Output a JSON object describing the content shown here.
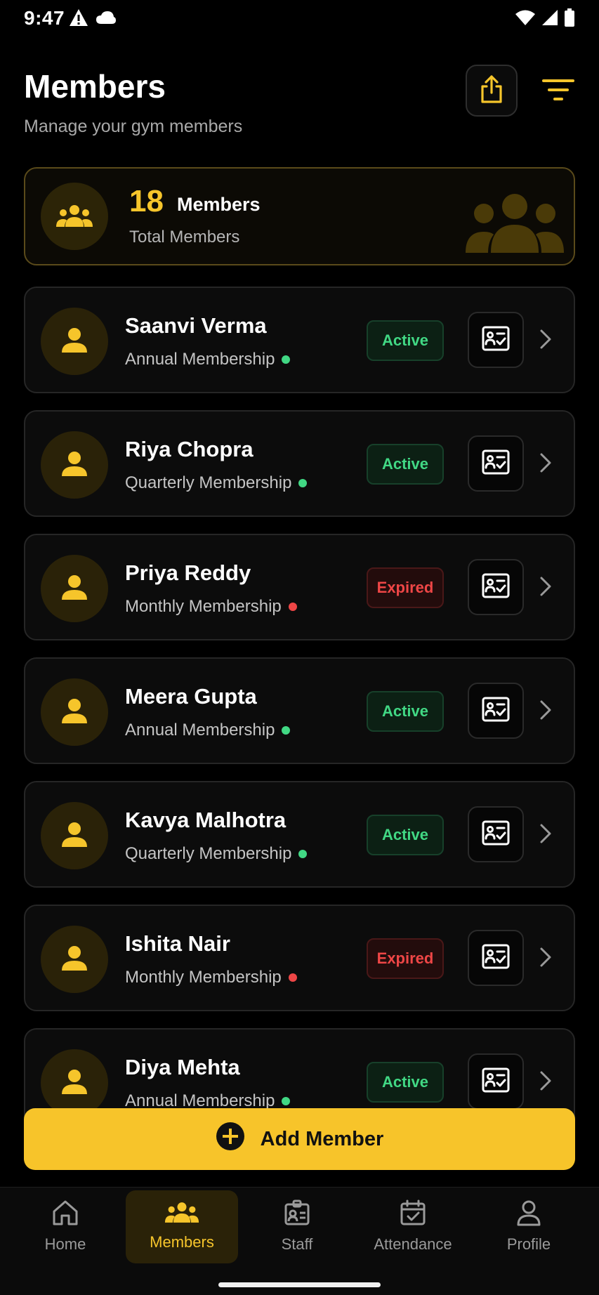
{
  "status_bar": {
    "time": "9:47"
  },
  "header": {
    "title": "Members",
    "subtitle": "Manage your gym members"
  },
  "summary": {
    "count": "18",
    "count_label": "Members",
    "label": "Total Members"
  },
  "members": [
    {
      "name": "Saanvi Verma",
      "plan": "Annual Membership",
      "status": "Active"
    },
    {
      "name": "Riya Chopra",
      "plan": "Quarterly Membership",
      "status": "Active"
    },
    {
      "name": "Priya Reddy",
      "plan": "Monthly Membership",
      "status": "Expired"
    },
    {
      "name": "Meera Gupta",
      "plan": "Annual Membership",
      "status": "Active"
    },
    {
      "name": "Kavya Malhotra",
      "plan": "Quarterly Membership",
      "status": "Active"
    },
    {
      "name": "Ishita Nair",
      "plan": "Monthly Membership",
      "status": "Expired"
    },
    {
      "name": "Diya Mehta",
      "plan": "Annual Membership",
      "status": "Active"
    }
  ],
  "add_button": {
    "label": "Add Member"
  },
  "nav": {
    "items": [
      {
        "label": "Home",
        "icon": "home-icon"
      },
      {
        "label": "Members",
        "icon": "members-icon"
      },
      {
        "label": "Staff",
        "icon": "staff-icon"
      },
      {
        "label": "Attendance",
        "icon": "attendance-icon"
      },
      {
        "label": "Profile",
        "icon": "profile-icon"
      }
    ],
    "active": "Members"
  },
  "colors": {
    "accent": "#f6c52b",
    "active_green": "#41d884",
    "expired_red": "#ee4646",
    "background": "#000000"
  }
}
